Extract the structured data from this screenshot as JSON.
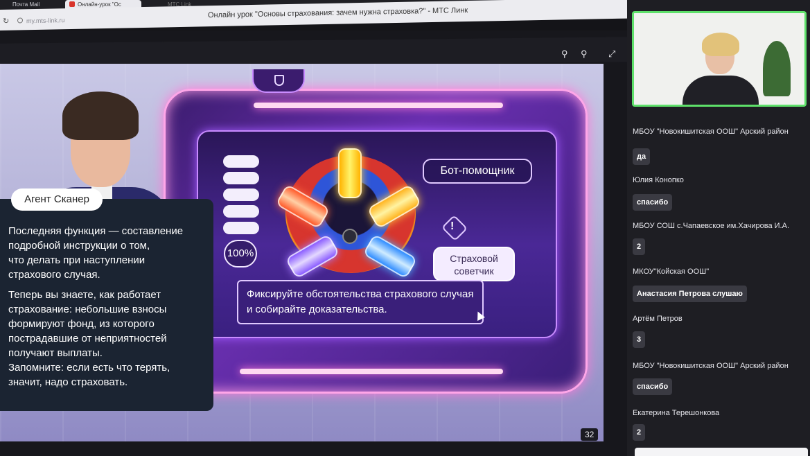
{
  "browser": {
    "tabs": [
      {
        "label": "Почта Mail"
      },
      {
        "label": "Онлайн-урок \"Ос"
      },
      {
        "label": "МТС Link"
      }
    ],
    "window_title": "Онлайн урок \"Основы страхования: зачем нужна страховка?\" - МТС Линк",
    "url": "my.mts-link.ru"
  },
  "toolbar": {
    "zoom_out_icon": "zoom-out-icon",
    "zoom_in_icon": "zoom-in-icon",
    "fullscreen_icon": "fullscreen-icon"
  },
  "slide": {
    "agent_name": "Агент Сканер",
    "narration": [
      "Последняя функция — составление\nподробной инструкции о том,\nчто делать при наступлении\nстрахового случая.",
      "Теперь вы знаете, как работает\nстрахование: небольшие взносы\nформируют фонд, из которого\nпострадавшие от неприятностей\nполучают выплаты.\nЗапомните: если есть что терять,\nзначит, надо страховать."
    ],
    "percent": "100%",
    "bot_label": "Бот-помощник",
    "advisor_label": "Страховой\nсоветчик",
    "message": "Фиксируйте обстоятельства страхового случая и собирайте доказательства.",
    "page_number": "32"
  },
  "chat": {
    "messages": [
      {
        "author": "МБОУ \"Новокишитская ООШ\" Арский район",
        "text": "да"
      },
      {
        "author": "Юлия Конопко",
        "text": "спасибо"
      },
      {
        "author": "МБОУ СОШ с.Чапаевское им.Хачирова И.А.",
        "text": "2"
      },
      {
        "author": "МКОУ\"Койская ООШ\"",
        "text": "Анастасия Петрова слушаю"
      },
      {
        "author": "Артём Петров",
        "text": "3"
      },
      {
        "author": "МБОУ \"Новокишитская ООШ\" Арский район",
        "text": "спасибо"
      },
      {
        "author": "Екатерина Терешонкова",
        "text": "2"
      }
    ]
  },
  "colors": {
    "speaker_border": "#5ee06a",
    "neon_pink": "#ff7ad9",
    "neon_violet": "#c98cff"
  }
}
